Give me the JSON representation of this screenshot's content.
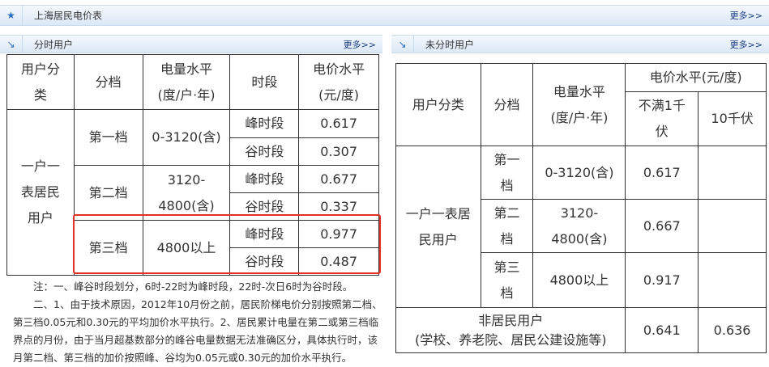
{
  "header": {
    "title": "上海居民电价表",
    "more": "更多>>"
  },
  "left": {
    "title": "分时用户",
    "more": "更多>>",
    "headers": [
      "用户分类",
      "分档",
      "电量水平(度/户·年)",
      "时段",
      "电价水平(元/度)"
    ],
    "category": "一户一表居民用户",
    "tiers": [
      {
        "name": "第一档",
        "range": "0-3120(含)",
        "peak_label": "峰时段",
        "peak": "0.617",
        "valley_label": "谷时段",
        "valley": "0.307"
      },
      {
        "name": "第二档",
        "range": "3120-4800(含)",
        "peak_label": "峰时段",
        "peak": "0.677",
        "valley_label": "谷时段",
        "valley": "0.337"
      },
      {
        "name": "第三档",
        "range": "4800以上",
        "peak_label": "峰时段",
        "peak": "0.977",
        "valley_label": "谷时段",
        "valley": "0.487"
      }
    ],
    "notes": [
      "注：一、峰谷时段划分，6时-22时为峰时段，22时-次日6时为谷时段。",
      "二、1、由于技术原因，2012年10月份之前，居民阶梯电价分别按照第二档、第三档0.05元和0.30元的平均加价水平执行。2、居民累计电量在第二或第三档临界点的月份，由于当月超基数部分的峰谷电量数据无法准确区分，具体执行时，该月第二档、第三档的加价按照峰、谷均为0.05元或0.30元的加价水平执行。"
    ]
  },
  "right": {
    "title": "未分时用户",
    "more": "更多>>",
    "headers": {
      "category": "用户分类",
      "tier": "分档",
      "usage": "电量水平(度/户·年)",
      "price": "电价水平(元/度)",
      "lt1kv": "不满1千伏",
      "kv10": "10千伏"
    },
    "category": "一户一表居民用户",
    "tiers": [
      {
        "name": "第一档",
        "range": "0-3120(含)",
        "price": "0.617",
        "price10": ""
      },
      {
        "name": "第二档",
        "range": "3120-4800(含)",
        "price": "0.667",
        "price10": ""
      },
      {
        "name": "第三档",
        "range": "4800以上",
        "price": "0.917",
        "price10": ""
      }
    ],
    "nonres": {
      "label": "非居民用户",
      "sub": "(学校、养老院、居民公建设施等)",
      "price": "0.641",
      "price10": "0.636"
    }
  }
}
